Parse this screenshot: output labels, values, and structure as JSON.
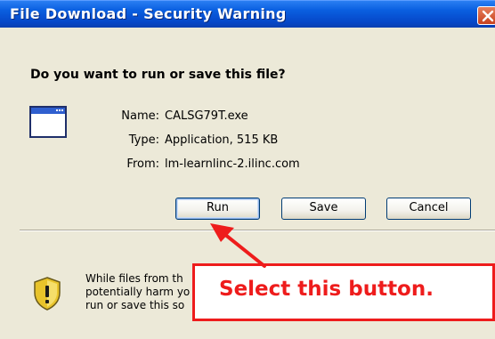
{
  "window": {
    "title": "File Download - Security Warning",
    "close_icon": "close-x-icon"
  },
  "dialog": {
    "question": "Do you want to run or save this file?",
    "file_icon": "application-window-icon",
    "fields": [
      {
        "label": "Name:",
        "value": "CALSG79T.exe"
      },
      {
        "label": "Type:",
        "value": "Application, 515 KB"
      },
      {
        "label": "From:",
        "value": "lm-learnlinc-2.ilinc.com"
      }
    ],
    "buttons": {
      "run": "Run",
      "save": "Save",
      "cancel": "Cancel"
    },
    "warning": {
      "icon": "security-shield-icon",
      "lines": [
        "While files from th",
        "potentially harm yo",
        "run or save this so"
      ]
    }
  },
  "annotation": {
    "callout_text": "Select this button.",
    "color": "#ee1c1c"
  },
  "colors": {
    "titlebar": "#0a5fe0",
    "dialog_bg": "#ece9d8",
    "callout": "#ee1c1c"
  }
}
